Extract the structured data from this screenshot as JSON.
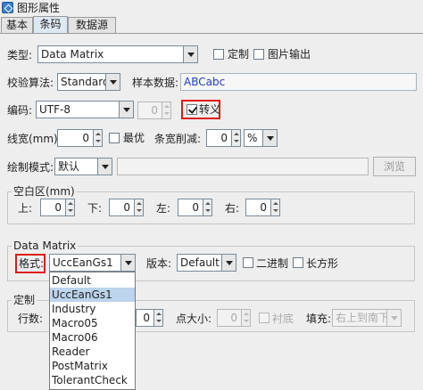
{
  "window": {
    "title": "图形属性"
  },
  "tabs": [
    "基本",
    "条码",
    "数据源"
  ],
  "row_type": {
    "label": "类型:",
    "value": "Data Matrix",
    "custom_label": "定制",
    "image_output_label": "图片输出"
  },
  "row_check": {
    "label": "校验算法:",
    "value": "Standard",
    "sample_label": "样本数据:",
    "sample_value": "ABCabc"
  },
  "row_encoding": {
    "label": "编码:",
    "value": "UTF-8",
    "spin_value": "0",
    "escape_label": "转义"
  },
  "row_line": {
    "label": "线宽(mm):",
    "value": "0",
    "optimal_label": "最优",
    "bar_reduce_label": "条宽削减:",
    "reduce_value": "0",
    "reduce_unit": "%"
  },
  "row_draw": {
    "label": "绘制模式:",
    "value": "默认",
    "browse_label": "浏览"
  },
  "blank_area": {
    "title": "空白区(mm)",
    "fields": [
      {
        "label": "上:",
        "value": "0"
      },
      {
        "label": "下:",
        "value": "0"
      },
      {
        "label": "左:",
        "value": "0"
      },
      {
        "label": "右:",
        "value": "0"
      }
    ]
  },
  "data_matrix": {
    "title": "Data Matrix",
    "format_label": "格式:",
    "format_value": "UccEanGs1",
    "version_label": "版本:",
    "version_value": "Default",
    "binary_label": "二进制",
    "rect_label": "长方形",
    "options": [
      "Default",
      "UccEanGs1",
      "Industry",
      "Macro05",
      "Macro06",
      "Reader",
      "PostMatrix",
      "TolerantCheck"
    ]
  },
  "custom": {
    "title": "定制",
    "rows_label": "行数:",
    "rows_value": "0",
    "dot_size_label": "点大小:",
    "dot_size_value": "0",
    "background_label": "衬底",
    "fill_label": "填充:",
    "fill_value": "右上到南下"
  }
}
